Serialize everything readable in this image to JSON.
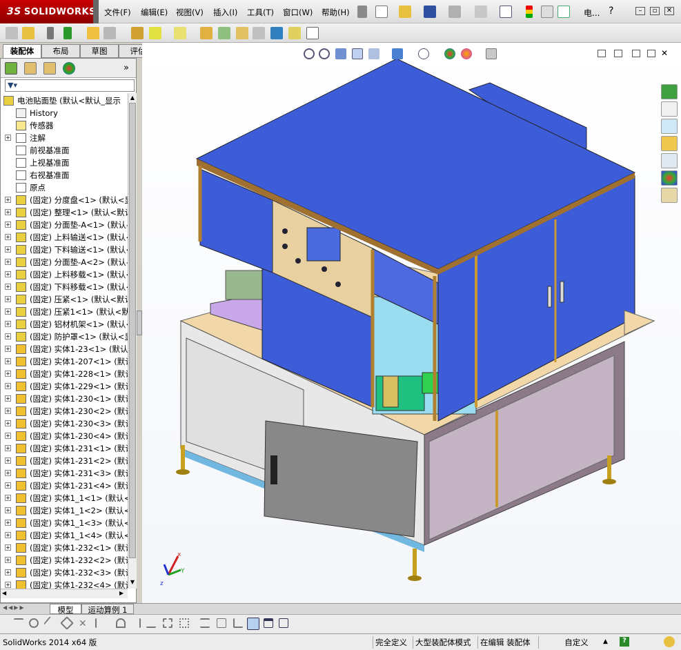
{
  "app": {
    "logo_ds": "3S",
    "logo_text": "SOLIDWORKS",
    "status_product": "SolidWorks 2014 x64 版"
  },
  "menu": [
    "文件(F)",
    "编辑(E)",
    "视图(V)",
    "插入(I)",
    "工具(T)",
    "窗口(W)",
    "帮助(H)"
  ],
  "search_label": "电...",
  "help_label": "?",
  "tabs": [
    "装配体",
    "布局",
    "草图",
    "评估"
  ],
  "tree": {
    "root": "电池贴面垫 (默认<默认_显示",
    "items": [
      {
        "label": "History",
        "icon": "history-icon",
        "expand": false
      },
      {
        "label": "传感器",
        "icon": "sensor-icon",
        "expand": false
      },
      {
        "label": "注解",
        "icon": "annotation-icon",
        "expand": true
      },
      {
        "label": "前视基准面",
        "icon": "plane-icon",
        "expand": false
      },
      {
        "label": "上视基准面",
        "icon": "plane-icon",
        "expand": false
      },
      {
        "label": "右视基准面",
        "icon": "plane-icon",
        "expand": false
      },
      {
        "label": "原点",
        "icon": "origin-icon",
        "expand": false
      },
      {
        "label": "(固定) 分度盘<1> (默认<显",
        "icon": "subassembly-icon",
        "expand": true
      },
      {
        "label": "(固定) 整理<1> (默认<默认",
        "icon": "subassembly-icon",
        "expand": true
      },
      {
        "label": "(固定) 分面垫-A<1> (默认-",
        "icon": "subassembly-icon",
        "expand": true
      },
      {
        "label": "(固定) 上料输送<1> (默认<",
        "icon": "subassembly-icon",
        "expand": true
      },
      {
        "label": "(固定) 下料输送<1> (默认<",
        "icon": "subassembly-icon",
        "expand": true
      },
      {
        "label": "(固定) 分面垫-A<2> (默认-",
        "icon": "subassembly-icon",
        "expand": true
      },
      {
        "label": "(固定) 上料移载<1> (默认<",
        "icon": "subassembly-icon",
        "expand": true
      },
      {
        "label": "(固定) 下料移载<1> (默认<",
        "icon": "subassembly-icon",
        "expand": true
      },
      {
        "label": "(固定) 压紧<1> (默认<默认",
        "icon": "subassembly-icon",
        "expand": true
      },
      {
        "label": "(固定) 压紧1<1> (默认<默",
        "icon": "subassembly-icon",
        "expand": true
      },
      {
        "label": "(固定) 铝材机架<1> (默认<",
        "icon": "subassembly-icon",
        "expand": true
      },
      {
        "label": "(固定) 防护罩<1> (默认<显",
        "icon": "subassembly-icon",
        "expand": true
      },
      {
        "label": "(固定) 实体1-23<1> (默认<",
        "icon": "part-icon",
        "expand": true
      },
      {
        "label": "(固定) 实体1-207<1> (默认",
        "icon": "part-icon",
        "expand": true
      },
      {
        "label": "(固定) 实体1-228<1> (默认",
        "icon": "part-icon",
        "expand": true
      },
      {
        "label": "(固定) 实体1-229<1> (默认",
        "icon": "part-icon",
        "expand": true
      },
      {
        "label": "(固定) 实体1-230<1> (默认",
        "icon": "part-icon",
        "expand": true
      },
      {
        "label": "(固定) 实体1-230<2> (默认",
        "icon": "part-icon",
        "expand": true
      },
      {
        "label": "(固定) 实体1-230<3> (默认",
        "icon": "part-icon",
        "expand": true
      },
      {
        "label": "(固定) 实体1-230<4> (默认",
        "icon": "part-icon",
        "expand": true
      },
      {
        "label": "(固定) 实体1-231<1> (默认",
        "icon": "part-icon",
        "expand": true
      },
      {
        "label": "(固定) 实体1-231<2> (默认",
        "icon": "part-icon",
        "expand": true
      },
      {
        "label": "(固定) 实体1-231<3> (默认",
        "icon": "part-icon",
        "expand": true
      },
      {
        "label": "(固定) 实体1-231<4> (默认",
        "icon": "part-icon",
        "expand": true
      },
      {
        "label": "(固定) 实体1_1<1> (默认<",
        "icon": "part-icon",
        "expand": true
      },
      {
        "label": "(固定) 实体1_1<2> (默认<",
        "icon": "part-icon",
        "expand": true
      },
      {
        "label": "(固定) 实体1_1<3> (默认<",
        "icon": "part-icon",
        "expand": true
      },
      {
        "label": "(固定) 实体1_1<4> (默认<",
        "icon": "part-icon",
        "expand": true
      },
      {
        "label": "(固定) 实体1-232<1> (默认",
        "icon": "part-icon",
        "expand": true
      },
      {
        "label": "(固定) 实体1-232<2> (默认",
        "icon": "part-icon",
        "expand": true
      },
      {
        "label": "(固定) 实体1-232<3> (默认",
        "icon": "part-icon",
        "expand": true
      },
      {
        "label": "(固定) 实体1-232<4> (默认",
        "icon": "part-icon",
        "expand": true
      }
    ]
  },
  "bottom_tabs": [
    "模型",
    "运动算例 1"
  ],
  "status": {
    "defined": "完全定义",
    "mode": "大型装配体模式",
    "editing": "在编辑 装配体",
    "custom": "自定义"
  },
  "colors": {
    "accent_red": "#c00000",
    "model_blue": "#3d5ad6",
    "panel_grey": "#e6e6e6",
    "mauve": "#8c7a88"
  }
}
